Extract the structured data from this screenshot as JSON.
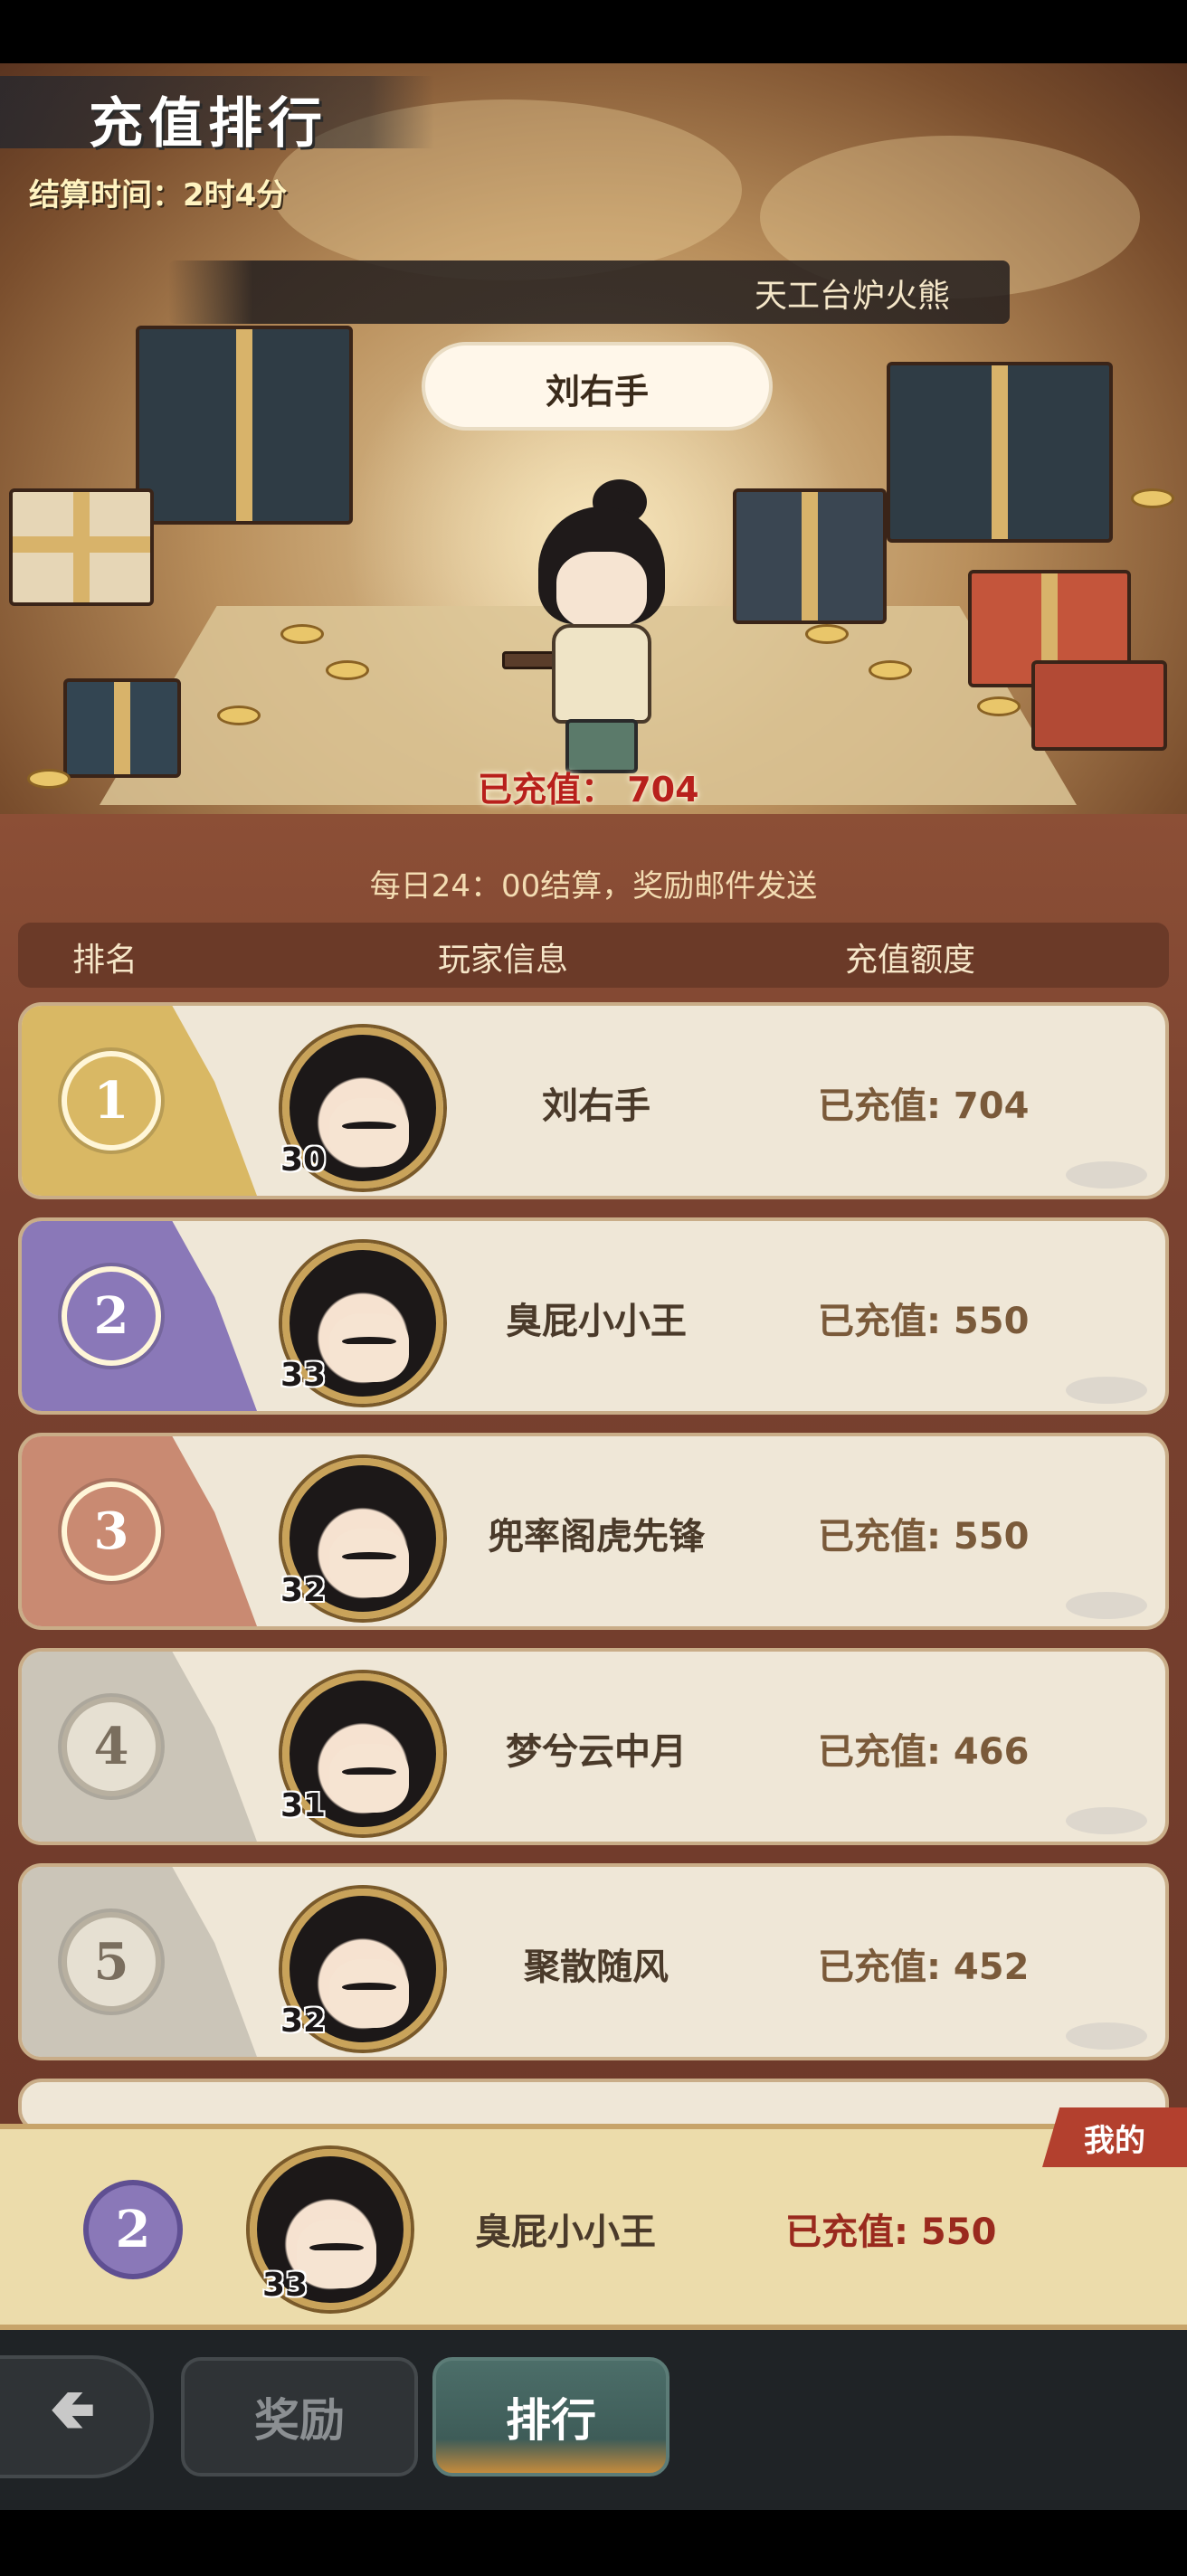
{
  "header": {
    "title": "充值排行",
    "settle_time": "结算时间：2时4分"
  },
  "hero": {
    "server_name": "天工台炉火熊",
    "top_player_name": "刘右手",
    "top_player_recharged": "已充值： 704"
  },
  "notice": "每日24：00结算，奖励邮件发送",
  "table": {
    "columns": [
      "排名",
      "玩家信息",
      "充值额度"
    ],
    "rows": [
      {
        "rank": "1",
        "level": "30",
        "name": "刘右手",
        "amount": "已充值: 704",
        "color": "#d9b864"
      },
      {
        "rank": "2",
        "level": "33",
        "name": "臭屁小小王",
        "amount": "已充值: 550",
        "color": "#8a78b8"
      },
      {
        "rank": "3",
        "level": "32",
        "name": "兜率阁虎先锋",
        "amount": "已充值: 550",
        "color": "#c98a72"
      },
      {
        "rank": "4",
        "level": "31",
        "name": "梦兮云中月",
        "amount": "已充值: 466",
        "color": "#cbc5b8"
      },
      {
        "rank": "5",
        "level": "32",
        "name": "聚散随风",
        "amount": "已充值: 452",
        "color": "#cbc5b8"
      }
    ]
  },
  "my_rank": {
    "tag": "我的",
    "rank": "2",
    "level": "33",
    "name": "臭屁小小王",
    "amount": "已充值: 550"
  },
  "nav": {
    "back_icon": "back-arrow-icon",
    "tabs": [
      {
        "label": "奖励",
        "active": false
      },
      {
        "label": "排行",
        "active": true
      }
    ]
  }
}
